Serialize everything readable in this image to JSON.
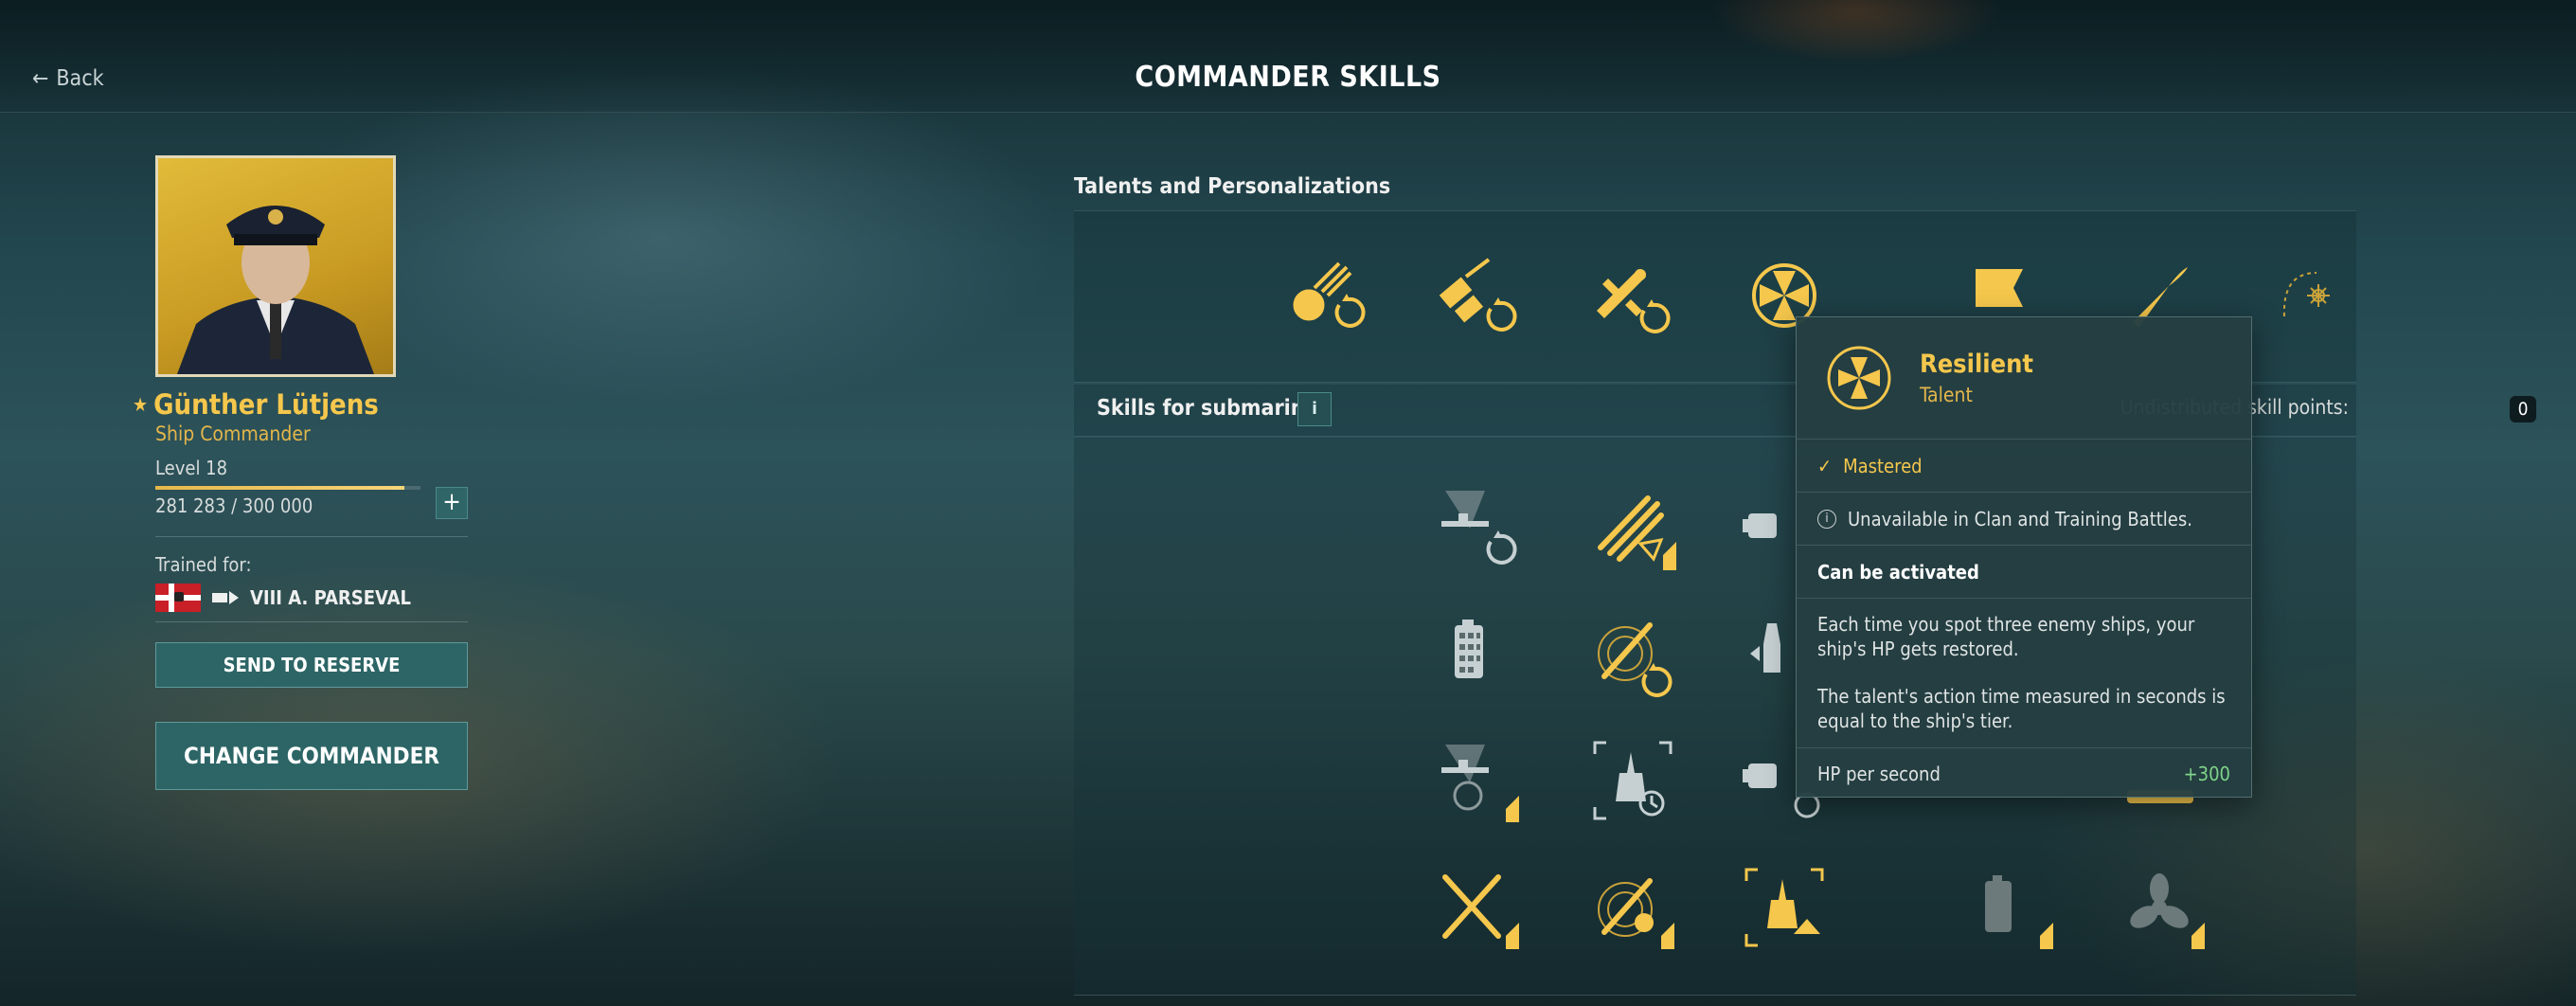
{
  "header": {
    "back_label": "Back",
    "title": "COMMANDER SKILLS"
  },
  "commander": {
    "name": "Günther Lütjens",
    "rank": "Ship Commander",
    "level": "Level 18",
    "xp_current": "281 283",
    "xp_max": "300 000",
    "xp_text": "281 283 / 300 000",
    "xp_progress": 0.9376,
    "trained_label": "Trained for:",
    "trained_ship": "VIII A. PARSEVAL",
    "send_to_reserve": "SEND TO RESERVE",
    "change_commander": "CHANGE COMMANDER"
  },
  "talents": {
    "title": "Talents and Personalizations"
  },
  "skills": {
    "title": "Skills for submarines",
    "info": "i",
    "points_label": "Undistributed skill points:",
    "points_value": "0"
  },
  "tooltip": {
    "title": "Resilient",
    "subtitle": "Talent",
    "mastered": "Mastered",
    "unavailable": "Unavailable in Clan and Training Battles.",
    "activation": "Can be activated",
    "desc_1": "Each time you spot three enemy ships, your ship's HP gets restored.",
    "desc_2": "The talent's action time measured in seconds is equal to the ship's tier.",
    "stat_label": "HP per second",
    "stat_value": "+300"
  },
  "colors": {
    "gold": "#f5c74c",
    "teal_button": "#2d6566",
    "stat_positive": "#7fd48a"
  }
}
